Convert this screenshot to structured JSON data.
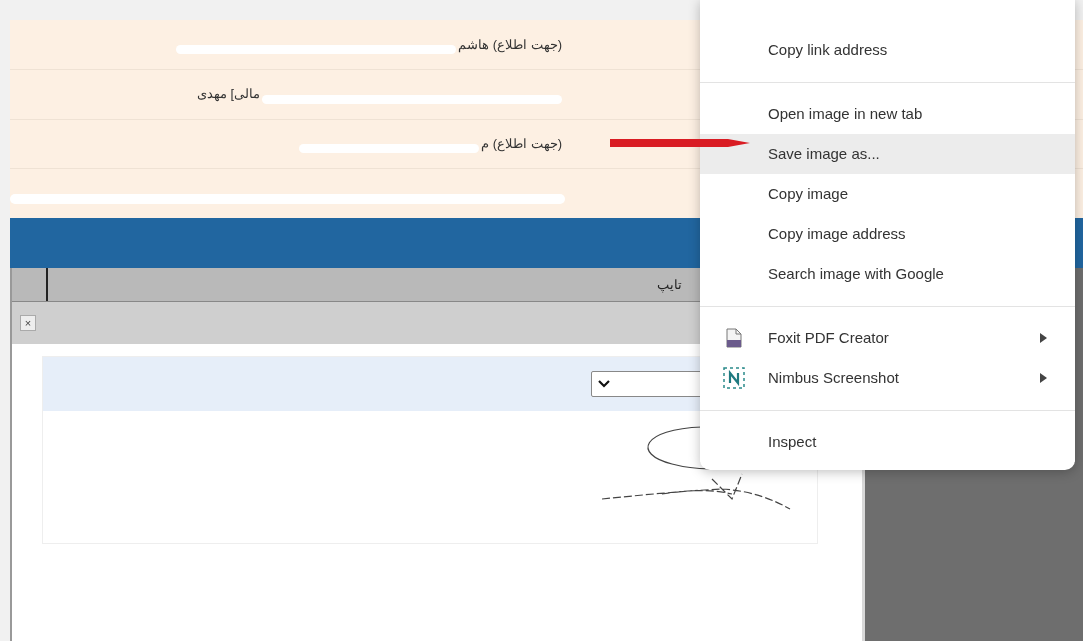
{
  "notifications": [
    {
      "text": "(جهت اطلاع) هاشم"
    },
    {
      "text": "مالی] مهدی"
    },
    {
      "text": "(جهت اطلاع) م"
    }
  ],
  "toolbar": {
    "label": "تایپ"
  },
  "dialog": {
    "close": "×"
  },
  "context_menu": {
    "items": [
      {
        "kind": "item",
        "label": "Copy link address",
        "selected": false
      },
      {
        "kind": "divider"
      },
      {
        "kind": "item",
        "label": "Open image in new tab",
        "selected": false
      },
      {
        "kind": "item",
        "label": "Save image as...",
        "selected": true
      },
      {
        "kind": "item",
        "label": "Copy image",
        "selected": false
      },
      {
        "kind": "item",
        "label": "Copy image address",
        "selected": false
      },
      {
        "kind": "item",
        "label": "Search image with Google",
        "selected": false
      },
      {
        "kind": "divider"
      },
      {
        "kind": "submenu",
        "label": "Foxit PDF Creator",
        "selected": false
      },
      {
        "kind": "submenu",
        "label": "Nimbus Screenshot",
        "selected": false
      },
      {
        "kind": "divider"
      },
      {
        "kind": "item",
        "label": "Inspect",
        "selected": false
      }
    ]
  }
}
